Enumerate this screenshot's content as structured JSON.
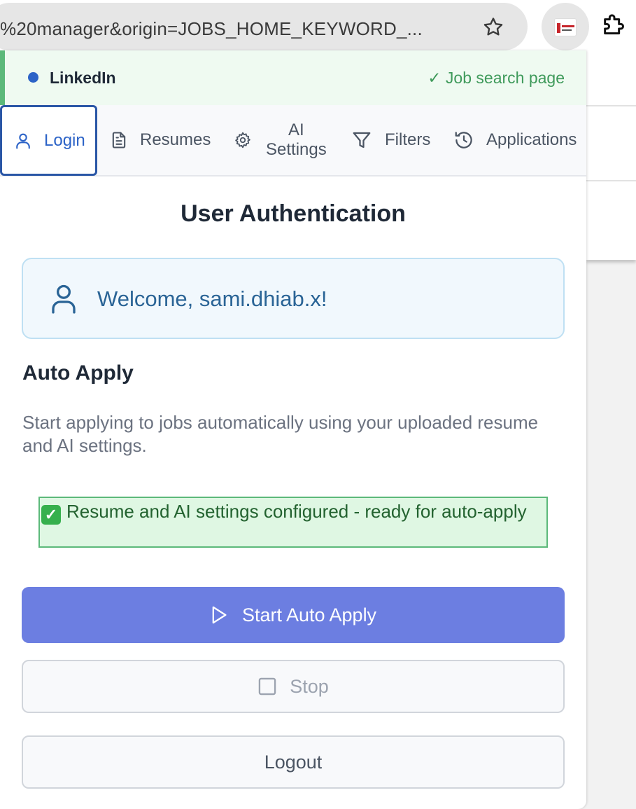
{
  "browser": {
    "url_text": "%20manager&origin=JOBS_HOME_KEYWORD_...",
    "icons": [
      "star-icon",
      "extension-logo",
      "puzzle-icon"
    ]
  },
  "status": {
    "site": "LinkedIn",
    "page_status": "✓ Job search page",
    "dot_color": "#2c63c7",
    "accent_color": "#5cb97a"
  },
  "tabs": [
    {
      "label": "Login",
      "icon": "user-icon",
      "active": true
    },
    {
      "label": "Resumes",
      "icon": "document-icon",
      "active": false
    },
    {
      "label": "AI Settings",
      "line1": "AI",
      "line2": "Settings",
      "icon": "gear-icon",
      "active": false
    },
    {
      "label": "Filters",
      "icon": "filter-icon",
      "active": false
    },
    {
      "label": "Applications",
      "icon": "history-icon",
      "active": false
    }
  ],
  "main": {
    "title": "User Authentication",
    "welcome": "Welcome, sami.dhiab.x!",
    "auto_apply": {
      "heading": "Auto Apply",
      "description": "Start applying to jobs automatically using your uploaded resume and AI settings.",
      "ready_check": "✓",
      "ready_message": "Resume and AI settings configured - ready for auto-apply"
    },
    "buttons": {
      "start": "Start Auto Apply",
      "stop": "Stop",
      "logout": "Logout"
    }
  },
  "colors": {
    "primary": "#6c7ee1",
    "active_tab": "#2c63c7",
    "success_bg": "#dff7e3"
  }
}
